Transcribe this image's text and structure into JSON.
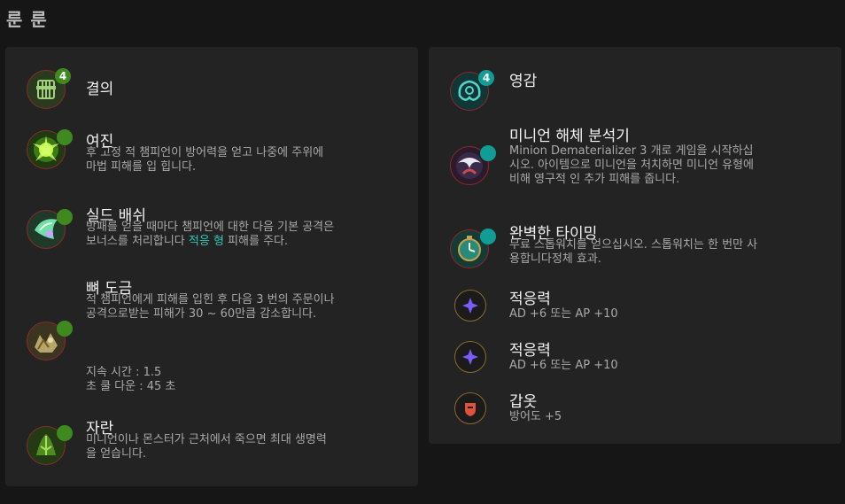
{
  "page": {
    "title": "룬 룬"
  },
  "left_tree": {
    "name": "결의",
    "badge": "4",
    "runes": [
      {
        "name": "여진",
        "desc": "후 고정 적 챔피언이 방어력을 얻고 나중에 주위에 마법 피해를 입 힙니다."
      },
      {
        "name": "실드 배쉬",
        "desc_prefix": "방패를 얻을 때마다 챔피언에 대한 다음 기본 공격은 보너스를 처리합니다 ",
        "desc_highlight": "적응 형",
        "desc_suffix": " 피해를 주다."
      },
      {
        "name": "뼈 도금",
        "desc": "적 챔피언에게 피해를 입힌 후 다음 3 번의 주문이나 공격으로받는 피해가 30 ~ 60만큼 감소합니다.",
        "duration": "지속 시간 : 1.5",
        "cooldown": "초 쿨 다운 : 45 초"
      },
      {
        "name": "자란",
        "desc": "미니언이나 몬스터가 근처에서 죽으면 최대 생명력을 얻습니다."
      }
    ]
  },
  "right_tree": {
    "name": "영감",
    "badge": "4",
    "runes": [
      {
        "name": "미니언 해체 분석기",
        "desc": "Minion Dematerializer 3 개로 게임을 시작하십시오. 아이템으로 미니언을 처치하면 미니언 유형에 비해 영구적 인 추가 피해를 줍니다."
      },
      {
        "name": "완벽한 타이밍",
        "desc": "무료 스톱워치를 얻으십시오. 스톱워치는 한 번만 사용합니다정체 효과."
      }
    ],
    "shards": [
      {
        "name": "적응력",
        "desc": "AD +6 또는 AP +10",
        "icon": "adaptive-shard-icon",
        "color": "#7b5cff"
      },
      {
        "name": "적응력",
        "desc": "AD +6 또는 AP +10",
        "icon": "adaptive-shard-icon",
        "color": "#7b5cff"
      },
      {
        "name": "갑옷",
        "desc": "방어도 +5",
        "icon": "armor-shard-icon",
        "color": "#e0503a"
      }
    ]
  },
  "colors": {
    "resolve_dot": "#3e8a1e",
    "inspiration_dot": "#0f9d95",
    "highlight": "#34c6b9"
  }
}
